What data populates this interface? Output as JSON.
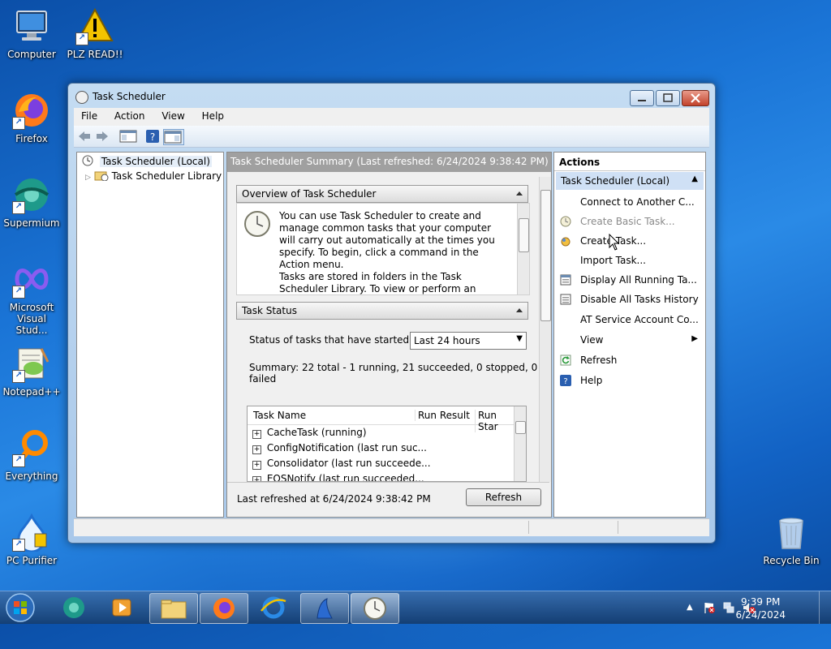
{
  "desktop": {
    "icons": [
      {
        "label": "Computer"
      },
      {
        "label": "PLZ READ!!"
      },
      {
        "label": "Firefox"
      },
      {
        "label": "Supermium"
      },
      {
        "label": "Microsoft Visual Stud..."
      },
      {
        "label": "Notepad++"
      },
      {
        "label": "Everything"
      },
      {
        "label": "PC Purifier"
      },
      {
        "label": "Recycle Bin"
      }
    ]
  },
  "window": {
    "title": "Task Scheduler",
    "menu": [
      "File",
      "Action",
      "View",
      "Help"
    ],
    "tree": {
      "root": "Task Scheduler (Local)",
      "child": "Task Scheduler Library"
    },
    "center": {
      "header": "Task Scheduler Summary (Last refreshed: 6/24/2024 9:38:42 PM)",
      "overview": {
        "title": "Overview of Task Scheduler",
        "text1": "You can use Task Scheduler to create and manage common tasks that your computer will carry out automatically at the times you specify. To begin, click a command in the Action menu.",
        "text2": "Tasks are stored in folders in the Task Scheduler Library. To view or perform an operation on an"
      },
      "status": {
        "title": "Task Status",
        "filter_label": "Status of tasks that have started i...",
        "filter_value": "Last 24 hours",
        "summary": "Summary: 22 total - 1 running, 21 succeeded, 0 stopped, 0 failed",
        "columns": [
          "Task Name",
          "Run Result",
          "Run Star"
        ],
        "rows": [
          "CacheTask (running)",
          "ConfigNotification (last run suc...",
          "Consolidator (last run succeede...",
          "EOSNotify (last run succeeded..."
        ]
      },
      "footer": {
        "last_refreshed": "Last refreshed at 6/24/2024 9:38:42 PM",
        "refresh_button": "Refresh"
      }
    },
    "actions": {
      "title": "Actions",
      "group": "Task Scheduler (Local)",
      "items": [
        {
          "label": "Connect to Another C...",
          "icon": "none",
          "disabled": false
        },
        {
          "label": "Create Basic Task...",
          "icon": "clock-wand-icon",
          "disabled": true
        },
        {
          "label": "Create Task...",
          "icon": "new-task-icon",
          "disabled": false
        },
        {
          "label": "Import Task...",
          "icon": "none",
          "disabled": false
        },
        {
          "label": "Display All Running Ta...",
          "icon": "running-tasks-icon",
          "disabled": false
        },
        {
          "label": "Disable All Tasks History",
          "icon": "history-icon",
          "disabled": false
        },
        {
          "label": "AT Service Account Co...",
          "icon": "none",
          "disabled": false
        },
        {
          "label": "View",
          "icon": "none",
          "disabled": false
        },
        {
          "label": "Refresh",
          "icon": "refresh-icon",
          "disabled": false
        },
        {
          "label": "Help",
          "icon": "help-icon",
          "disabled": false
        }
      ]
    }
  },
  "taskbar": {
    "time": "9:39 PM",
    "date": "6/24/2024"
  },
  "colors": {
    "window_frame": "#b6d0ee",
    "center_header": "#a0a0a0",
    "actions_group": "#cfe0f5"
  }
}
